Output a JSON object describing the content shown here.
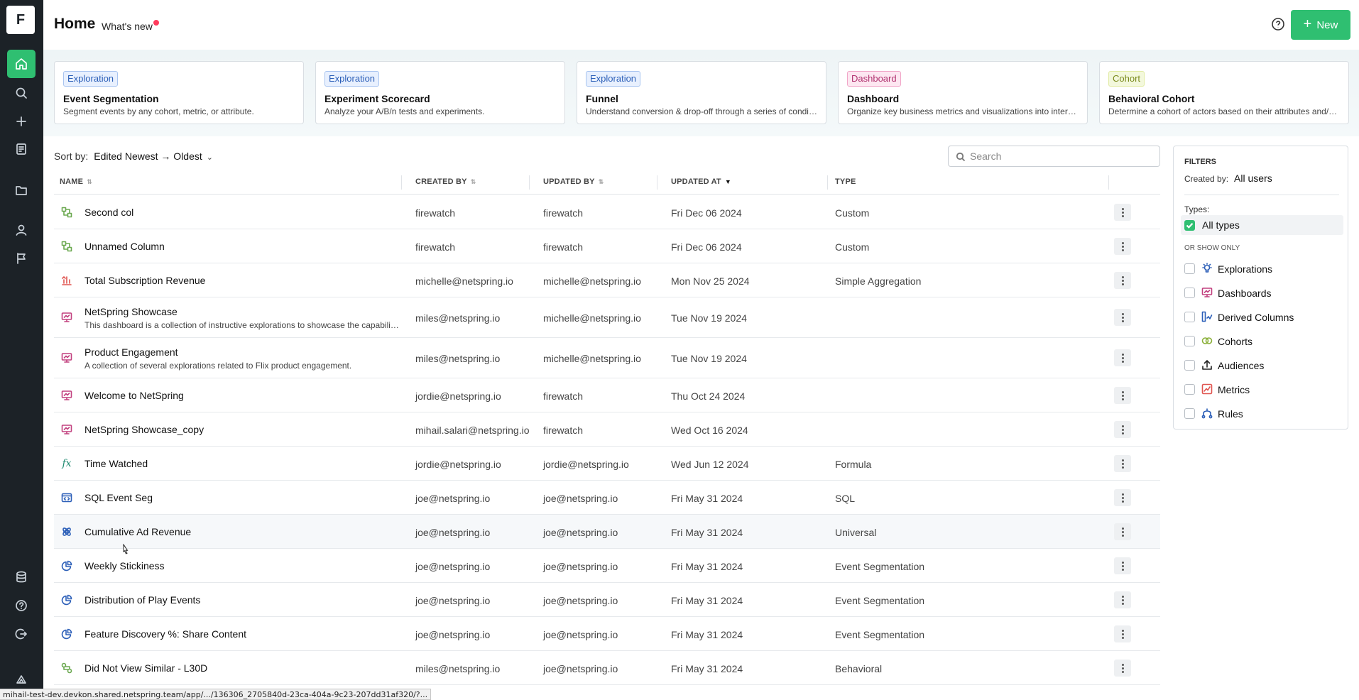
{
  "app": {
    "logo_letter": "F",
    "page_title": "Home",
    "whats_new": "What's new",
    "new_button": "New",
    "accent": "#2fbf71"
  },
  "nav": [
    {
      "name": "home",
      "icon": "home-icon"
    },
    {
      "name": "search",
      "icon": "search-icon"
    },
    {
      "name": "create",
      "icon": "plus-icon"
    },
    {
      "name": "notebooks",
      "icon": "notebook-icon"
    },
    {
      "name": "folders",
      "icon": "folder-icon"
    },
    {
      "name": "people",
      "icon": "user-icon"
    },
    {
      "name": "flags",
      "icon": "flag-icon"
    },
    {
      "name": "data",
      "icon": "database-icon"
    },
    {
      "name": "help",
      "icon": "help-icon"
    },
    {
      "name": "logout",
      "icon": "logout-icon"
    },
    {
      "name": "brand",
      "icon": "brand-icon"
    }
  ],
  "templates": [
    {
      "tag": "Exploration",
      "tag_kind": "explo",
      "title": "Event Segmentation",
      "desc": "Segment events by any cohort, metric, or attribute."
    },
    {
      "tag": "Exploration",
      "tag_kind": "explo",
      "title": "Experiment Scorecard",
      "desc": "Analyze your A/B/n tests and experiments."
    },
    {
      "tag": "Exploration",
      "tag_kind": "explo",
      "title": "Funnel",
      "desc": "Understand conversion & drop-off through a series of conditi..."
    },
    {
      "tag": "Dashboard",
      "tag_kind": "dash",
      "title": "Dashboard",
      "desc": "Organize key business metrics and visualizations into interacti..."
    },
    {
      "tag": "Cohort",
      "tag_kind": "cohort",
      "title": "Behavioral Cohort",
      "desc": "Determine a cohort of actors based on their attributes and/or ..."
    }
  ],
  "sort": {
    "label": "Sort by:",
    "value": "Edited Newest → Oldest"
  },
  "search": {
    "placeholder": "Search"
  },
  "columns": {
    "name": "NAME",
    "created_by": "CREATED BY",
    "updated_by": "UPDATED BY",
    "updated_at": "UPDATED AT",
    "type": "TYPE"
  },
  "rows": [
    {
      "icon": "derived-column",
      "name": "Second col",
      "desc": "",
      "created_by": "firewatch",
      "updated_by": "firewatch",
      "updated_at": "Fri Dec 06 2024",
      "type": "Custom"
    },
    {
      "icon": "derived-column",
      "name": "Unnamed Column",
      "desc": "",
      "created_by": "firewatch",
      "updated_by": "firewatch",
      "updated_at": "Fri Dec 06 2024",
      "type": "Custom"
    },
    {
      "icon": "aggregation",
      "name": "Total Subscription Revenue",
      "desc": "",
      "created_by": "michelle@netspring.io",
      "updated_by": "michelle@netspring.io",
      "updated_at": "Mon Nov 25 2024",
      "type": "Simple Aggregation"
    },
    {
      "icon": "dashboard",
      "name": "NetSpring Showcase",
      "desc": "This dashboard is a collection of instructive explorations to showcase the capabilities ...",
      "created_by": "miles@netspring.io",
      "updated_by": "michelle@netspring.io",
      "updated_at": "Tue Nov 19 2024",
      "type": ""
    },
    {
      "icon": "dashboard",
      "name": "Product Engagement",
      "desc": "A collection of several explorations related to Flix product engagement.",
      "created_by": "miles@netspring.io",
      "updated_by": "michelle@netspring.io",
      "updated_at": "Tue Nov 19 2024",
      "type": ""
    },
    {
      "icon": "dashboard",
      "name": "Welcome to NetSpring",
      "desc": "",
      "created_by": "jordie@netspring.io",
      "updated_by": "firewatch",
      "updated_at": "Thu Oct 24 2024",
      "type": ""
    },
    {
      "icon": "dashboard",
      "name": "NetSpring Showcase_copy",
      "desc": "",
      "created_by": "mihail.salari@netspring.io",
      "updated_by": "firewatch",
      "updated_at": "Wed Oct 16 2024",
      "type": ""
    },
    {
      "icon": "formula",
      "name": "Time Watched",
      "desc": "",
      "created_by": "jordie@netspring.io",
      "updated_by": "jordie@netspring.io",
      "updated_at": "Wed Jun 12 2024",
      "type": "Formula"
    },
    {
      "icon": "sql",
      "name": "SQL Event Seg",
      "desc": "",
      "created_by": "joe@netspring.io",
      "updated_by": "joe@netspring.io",
      "updated_at": "Fri May 31 2024",
      "type": "SQL"
    },
    {
      "icon": "universal",
      "name": "Cumulative Ad Revenue",
      "desc": "",
      "created_by": "joe@netspring.io",
      "updated_by": "joe@netspring.io",
      "updated_at": "Fri May 31 2024",
      "type": "Universal"
    },
    {
      "icon": "event-seg",
      "name": "Weekly Stickiness",
      "desc": "",
      "created_by": "joe@netspring.io",
      "updated_by": "joe@netspring.io",
      "updated_at": "Fri May 31 2024",
      "type": "Event Segmentation"
    },
    {
      "icon": "event-seg",
      "name": "Distribution of Play Events",
      "desc": "",
      "created_by": "joe@netspring.io",
      "updated_by": "joe@netspring.io",
      "updated_at": "Fri May 31 2024",
      "type": "Event Segmentation"
    },
    {
      "icon": "event-seg",
      "name": "Feature Discovery %: Share Content",
      "desc": "",
      "created_by": "joe@netspring.io",
      "updated_by": "joe@netspring.io",
      "updated_at": "Fri May 31 2024",
      "type": "Event Segmentation"
    },
    {
      "icon": "behavioral",
      "name": "Did Not View Similar - L30D",
      "desc": "",
      "created_by": "miles@netspring.io",
      "updated_by": "joe@netspring.io",
      "updated_at": "Fri May 31 2024",
      "type": "Behavioral"
    }
  ],
  "filters": {
    "title": "FILTERS",
    "created_by_label": "Created by:",
    "created_by_value": "All users",
    "types_label": "Types:",
    "all_types": "All types",
    "or_show_only": "OR SHOW ONLY",
    "items": [
      {
        "label": "Explorations",
        "icon": "lightbulb-icon"
      },
      {
        "label": "Dashboards",
        "icon": "dashboard-icon"
      },
      {
        "label": "Derived Columns",
        "icon": "derived-column-icon"
      },
      {
        "label": "Cohorts",
        "icon": "cohort-icon"
      },
      {
        "label": "Audiences",
        "icon": "upload-icon"
      },
      {
        "label": "Metrics",
        "icon": "metric-icon"
      },
      {
        "label": "Rules",
        "icon": "rules-icon"
      }
    ]
  },
  "status_url": "mihail-test-dev.devkon.shared.netspring.team/app/.../136306_2705840d-23ca-404a-9c23-207dd31af320/?..."
}
